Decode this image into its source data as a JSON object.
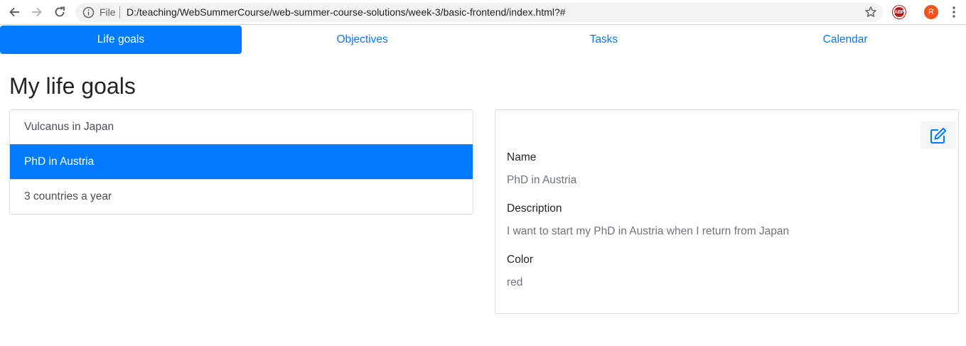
{
  "browser": {
    "file_label": "File",
    "url": "D:/teaching/WebSummerCourse/web-summer-course-solutions/week-3/basic-frontend/index.html?#",
    "abp_label": "ABP",
    "avatar_letter": "R"
  },
  "tabs": [
    {
      "label": "Life goals",
      "active": true
    },
    {
      "label": "Objectives",
      "active": false
    },
    {
      "label": "Tasks",
      "active": false
    },
    {
      "label": "Calendar",
      "active": false
    }
  ],
  "page": {
    "title": "My life goals"
  },
  "goals": [
    {
      "label": "Vulcanus in Japan",
      "selected": false
    },
    {
      "label": "PhD in Austria",
      "selected": true
    },
    {
      "label": "3 countries a year",
      "selected": false
    }
  ],
  "detail": {
    "name_label": "Name",
    "name_value": "PhD in Austria",
    "description_label": "Description",
    "description_value": "I want to start my PhD in Austria when I return from Japan",
    "color_label": "Color",
    "color_value": "red"
  },
  "colors": {
    "primary": "#007bff",
    "muted": "#6c757d"
  },
  "icons": {
    "back": "arrow-left-icon",
    "forward": "arrow-right-icon",
    "reload": "reload-icon",
    "info": "info-icon",
    "bookmark": "star-icon",
    "menu": "kebab-menu-icon",
    "edit": "edit-icon"
  }
}
